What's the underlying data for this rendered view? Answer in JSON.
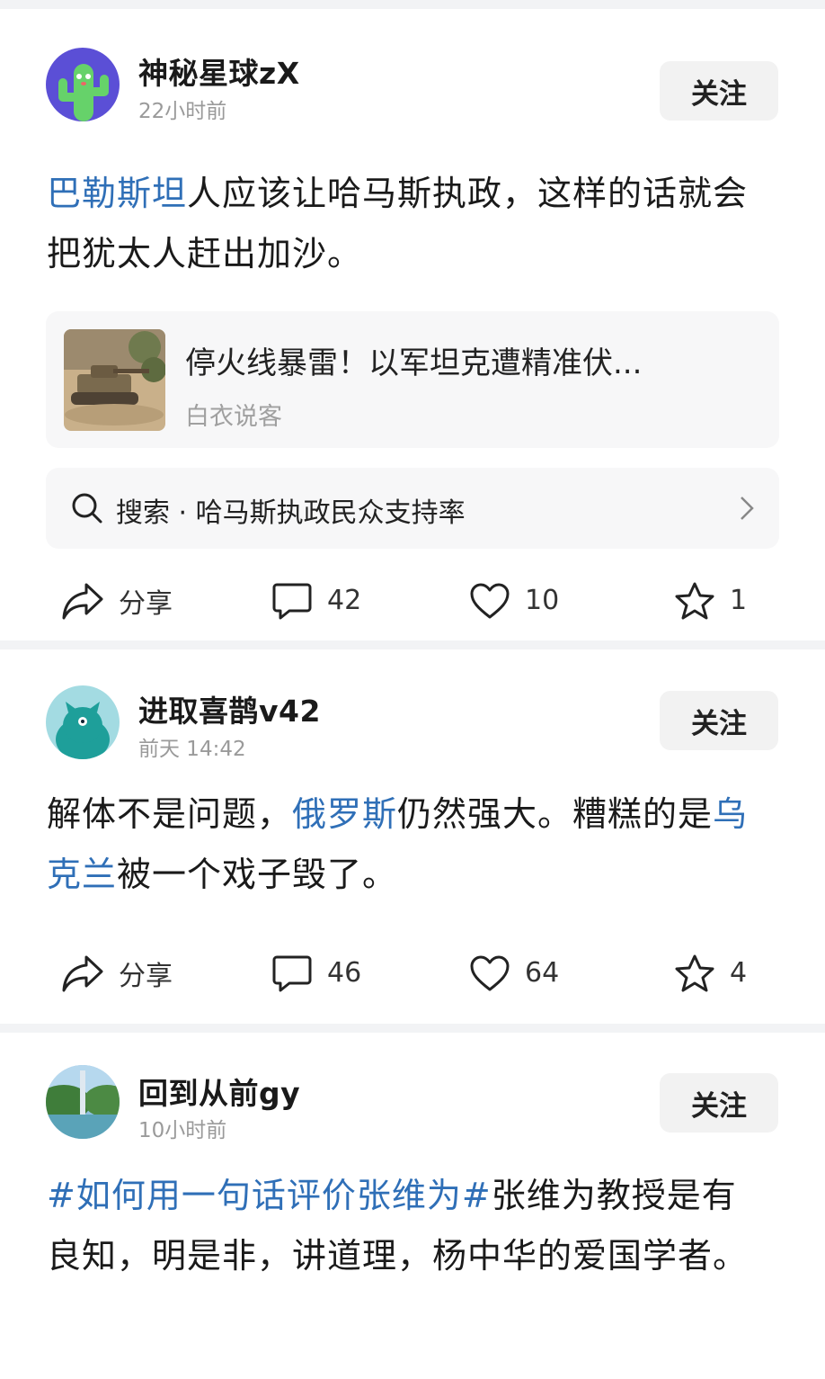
{
  "posts": [
    {
      "username": "神秘星球zX",
      "time": "22小时前",
      "follow_label": "关注",
      "content_parts": [
        {
          "text": "巴勒斯坦",
          "link": true
        },
        {
          "text": "人应该让哈马斯执政，这样的话就会把犹太人赶出加沙。",
          "link": false
        }
      ],
      "article": {
        "title": "停火线暴雷！以军坦克遭精准伏...",
        "source": "白衣说客"
      },
      "search": {
        "text": "搜索 · 哈马斯执政民众支持率"
      },
      "share_label": "分享",
      "comments": "42",
      "likes": "10",
      "favorites": "1"
    },
    {
      "username": "进取喜鹊v42",
      "time": "前天 14:42",
      "follow_label": "关注",
      "content_parts": [
        {
          "text": "解体不是问题，",
          "link": false
        },
        {
          "text": "俄罗斯",
          "link": true
        },
        {
          "text": "仍然强大。糟糕的是",
          "link": false
        },
        {
          "text": "乌克兰",
          "link": true
        },
        {
          "text": "被一个戏子毁了。",
          "link": false
        }
      ],
      "share_label": "分享",
      "comments": "46",
      "likes": "64",
      "favorites": "4"
    },
    {
      "username": "回到从前gy",
      "time": "10小时前",
      "follow_label": "关注",
      "content_parts": [
        {
          "text": "#如何用一句话评价张维为#",
          "link": true
        },
        {
          "text": "张维为教授是有良知，明是非，讲道理，杨中华的爱国学者。",
          "link": false
        }
      ]
    }
  ]
}
